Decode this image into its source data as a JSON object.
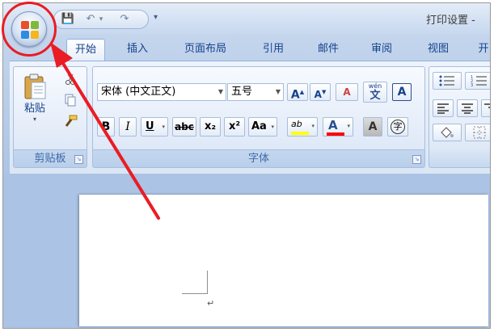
{
  "window": {
    "title": "打印设置 -"
  },
  "qat": {
    "save": "💾",
    "undo": "↶",
    "redo": "↷",
    "customize": "▾"
  },
  "tabs": [
    "开始",
    "插入",
    "页面布局",
    "引用",
    "邮件",
    "审阅",
    "视图",
    "开"
  ],
  "clipboard": {
    "paste_label": "粘贴",
    "group_label": "剪贴板"
  },
  "font": {
    "name": "宋体 (中文正文)",
    "size": "五号",
    "grow": "A",
    "shrink": "A",
    "clear_format": "A",
    "phonetic_top": "wén",
    "phonetic_bottom": "文",
    "char_border": "A",
    "bold": "B",
    "italic": "I",
    "underline": "U",
    "strike": "abc",
    "subscript": "x₂",
    "superscript": "x²",
    "change_case": "Aa",
    "highlight": "ab",
    "font_color": "A",
    "char_shading": "A",
    "enclose": "字",
    "group_label": "字体"
  },
  "colors": {
    "accent_red": "#ea1c24",
    "highlight_yellow": "#ffff00",
    "font_red": "#ff0000"
  },
  "doc": {
    "para_mark": "↵"
  }
}
